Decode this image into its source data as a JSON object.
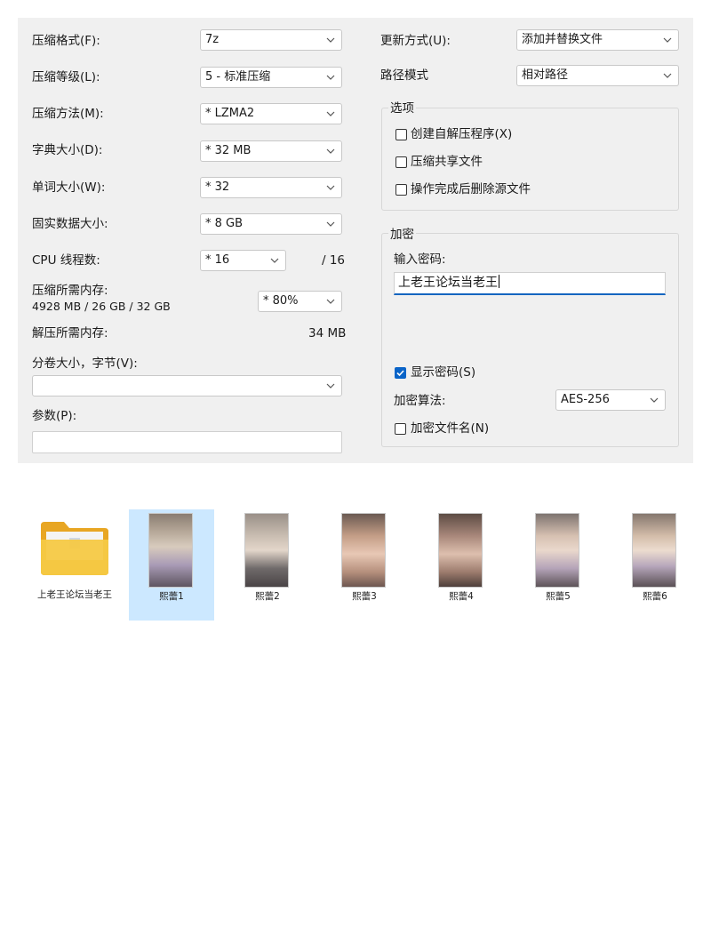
{
  "dialog": {
    "left": {
      "format": {
        "label": "压缩格式(F):",
        "value": "7z"
      },
      "level": {
        "label": "压缩等级(L):",
        "value": "5 - 标准压缩"
      },
      "method": {
        "label": "压缩方法(M):",
        "value": "* LZMA2"
      },
      "dict": {
        "label": "字典大小(D):",
        "value": "* 32 MB"
      },
      "word": {
        "label": "单词大小(W):",
        "value": "* 32"
      },
      "solid": {
        "label": "固实数据大小:",
        "value": "* 8 GB"
      },
      "cpu": {
        "label": "CPU 线程数:",
        "value": "* 16",
        "max": "/ 16"
      },
      "mem_compress": {
        "label": "压缩所需内存:",
        "detail": "4928 MB / 26 GB / 32 GB",
        "value": "* 80%"
      },
      "mem_decompress": {
        "label": "解压所需内存:",
        "value": "34 MB"
      },
      "volume": {
        "label": "分卷大小，字节(V):",
        "value": ""
      },
      "params": {
        "label": "参数(P):",
        "value": ""
      }
    },
    "right": {
      "update": {
        "label": "更新方式(U):",
        "value": "添加并替换文件"
      },
      "path": {
        "label": "路径模式",
        "value": "相对路径"
      },
      "options": {
        "title": "选项",
        "sfx": "创建自解压程序(X)",
        "shared": "压缩共享文件",
        "delete": "操作完成后删除源文件"
      },
      "encryption": {
        "title": "加密",
        "pw_label": "输入密码:",
        "pw_value": "上老王论坛当老王",
        "show_pw": "显示密码(S)",
        "algo_label": "加密算法:",
        "algo_value": "AES-256",
        "encrypt_names": "加密文件名(N)"
      }
    }
  },
  "files": [
    {
      "name": "上老王论坛当老王",
      "type": "folder"
    },
    {
      "name": "熙蕾1"
    },
    {
      "name": "熙蕾2"
    },
    {
      "name": "熙蕾3"
    },
    {
      "name": "熙蕾4"
    },
    {
      "name": "熙蕾5"
    },
    {
      "name": "熙蕾6"
    }
  ],
  "colors": {
    "dialog_bg": "#f0f0f0",
    "accent": "#0a64c8",
    "selection": "#cce8ff",
    "folder": "#f5c542"
  }
}
